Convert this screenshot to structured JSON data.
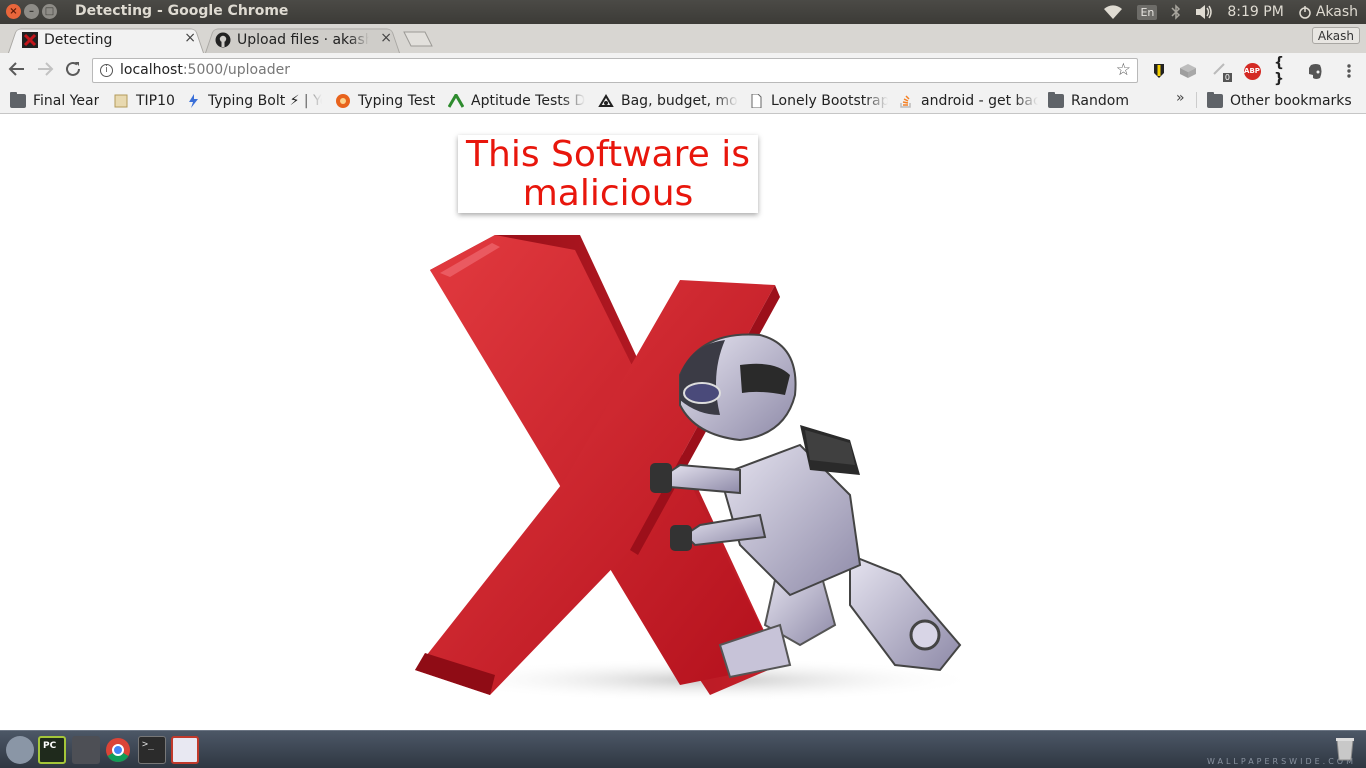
{
  "window": {
    "title": "Detecting - Google Chrome",
    "buttons": [
      "×",
      "–",
      "□"
    ]
  },
  "tray": {
    "language": "En",
    "time": "8:19 PM",
    "user": "Akash"
  },
  "tabs": [
    {
      "label": "Detecting",
      "close": "×",
      "active": true
    },
    {
      "label": "Upload files · akash",
      "close": "×",
      "active": false
    }
  ],
  "profile_button": "Akash",
  "address_bar": {
    "host": "localhost",
    "path": ":5000/uploader"
  },
  "bookmarks": [
    {
      "label": "Final Year",
      "icon": "folder-icon"
    },
    {
      "label": "TIP10",
      "icon": "tip10-favicon"
    },
    {
      "label": "Typing Bolt ⚡ | Yo",
      "icon": "typing-bolt-favicon"
    },
    {
      "label": "Typing Test",
      "icon": "typing-test-favicon"
    },
    {
      "label": "Aptitude Tests D",
      "icon": "aptitude-favicon"
    },
    {
      "label": "Bag, budget, mo",
      "icon": "bag-favicon"
    },
    {
      "label": "Lonely Bootstrap",
      "icon": "page-icon"
    },
    {
      "label": "android - get bac",
      "icon": "stackoverflow-favicon"
    },
    {
      "label": "Random",
      "icon": "folder-icon"
    }
  ],
  "bookmarks_overflow": "»",
  "other_bookmarks": "Other bookmarks",
  "extensions": {
    "badge_count": "0",
    "abp": "ABP",
    "json": "{ }"
  },
  "page": {
    "verdict_line1": "This Software is",
    "verdict_line2": "malicious",
    "verdict_color": "#e8160c"
  },
  "taskbar": {
    "watermark": "WALLPAPERSWIDE.COM",
    "apps": [
      "system-icon",
      "pycharm-icon",
      "files-icon",
      "chrome-icon",
      "terminal-icon",
      "finder-icon"
    ]
  }
}
